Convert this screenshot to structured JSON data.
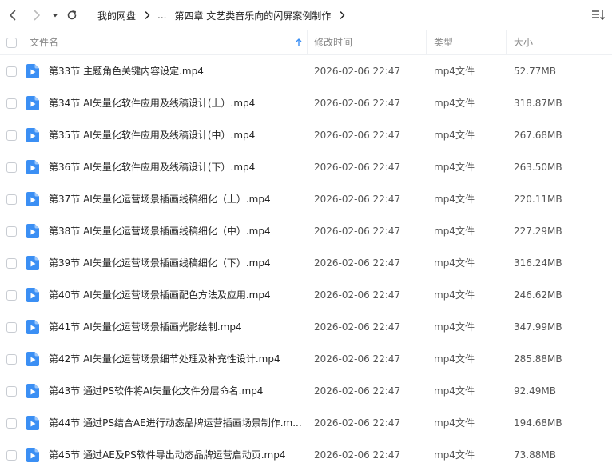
{
  "breadcrumb": {
    "root": "我的网盘",
    "ellipsis": "...",
    "current": "第四章 文艺类音乐向的闪屏案例制作"
  },
  "icons": {
    "back": "chevron-left-icon",
    "forward": "chevron-right-icon",
    "history": "dropdown-triangle-icon",
    "refresh": "refresh-icon",
    "sort": "sort-list-icon",
    "file": "video-file-icon",
    "sort_arrow": "sort-ascending-arrow-icon"
  },
  "colors": {
    "file_icon": "#3b8ff4",
    "sort_arrow": "#3b8ff4"
  },
  "columns": {
    "name": "文件名",
    "time": "修改时间",
    "type": "类型",
    "size": "大小"
  },
  "files": [
    {
      "name": "第33节 主题角色关键内容设定.mp4",
      "time": "2026-02-06 22:47",
      "type": "mp4文件",
      "size": "52.77MB"
    },
    {
      "name": "第34节 AI矢量化软件应用及线稿设计(上）.mp4",
      "time": "2026-02-06 22:47",
      "type": "mp4文件",
      "size": "318.87MB"
    },
    {
      "name": "第35节 AI矢量化软件应用及线稿设计(中）.mp4",
      "time": "2026-02-06 22:47",
      "type": "mp4文件",
      "size": "267.68MB"
    },
    {
      "name": "第36节 AI矢量化软件应用及线稿设计(下）.mp4",
      "time": "2026-02-06 22:47",
      "type": "mp4文件",
      "size": "263.50MB"
    },
    {
      "name": "第37节 AI矢量化运营场景插画线稿细化（上）.mp4",
      "time": "2026-02-06 22:47",
      "type": "mp4文件",
      "size": "220.11MB"
    },
    {
      "name": "第38节 AI矢量化运营场景插画线稿细化（中）.mp4",
      "time": "2026-02-06 22:47",
      "type": "mp4文件",
      "size": "227.29MB"
    },
    {
      "name": "第39节 AI矢量化运营场景插画线稿细化（下）.mp4",
      "time": "2026-02-06 22:47",
      "type": "mp4文件",
      "size": "316.24MB"
    },
    {
      "name": "第40节 AI矢量化运营场景插画配色方法及应用.mp4",
      "time": "2026-02-06 22:47",
      "type": "mp4文件",
      "size": "246.62MB"
    },
    {
      "name": "第41节 AI矢量化运营场景插画光影绘制.mp4",
      "time": "2026-02-06 22:47",
      "type": "mp4文件",
      "size": "347.99MB"
    },
    {
      "name": "第42节 AI矢量化运营场景细节处理及补充性设计.mp4",
      "time": "2026-02-06 22:47",
      "type": "mp4文件",
      "size": "285.88MB"
    },
    {
      "name": "第43节 通过PS软件将AI矢量化文件分层命名.mp4",
      "time": "2026-02-06 22:47",
      "type": "mp4文件",
      "size": "92.49MB"
    },
    {
      "name": "第44节 通过PS结合AE进行动态品牌运营插画场景制作.m...",
      "time": "2026-02-06 22:47",
      "type": "mp4文件",
      "size": "194.68MB"
    },
    {
      "name": "第45节 通过AE及PS软件导出动态品牌运营启动页.mp4",
      "time": "2026-02-06 22:47",
      "type": "mp4文件",
      "size": "73.88MB"
    }
  ]
}
